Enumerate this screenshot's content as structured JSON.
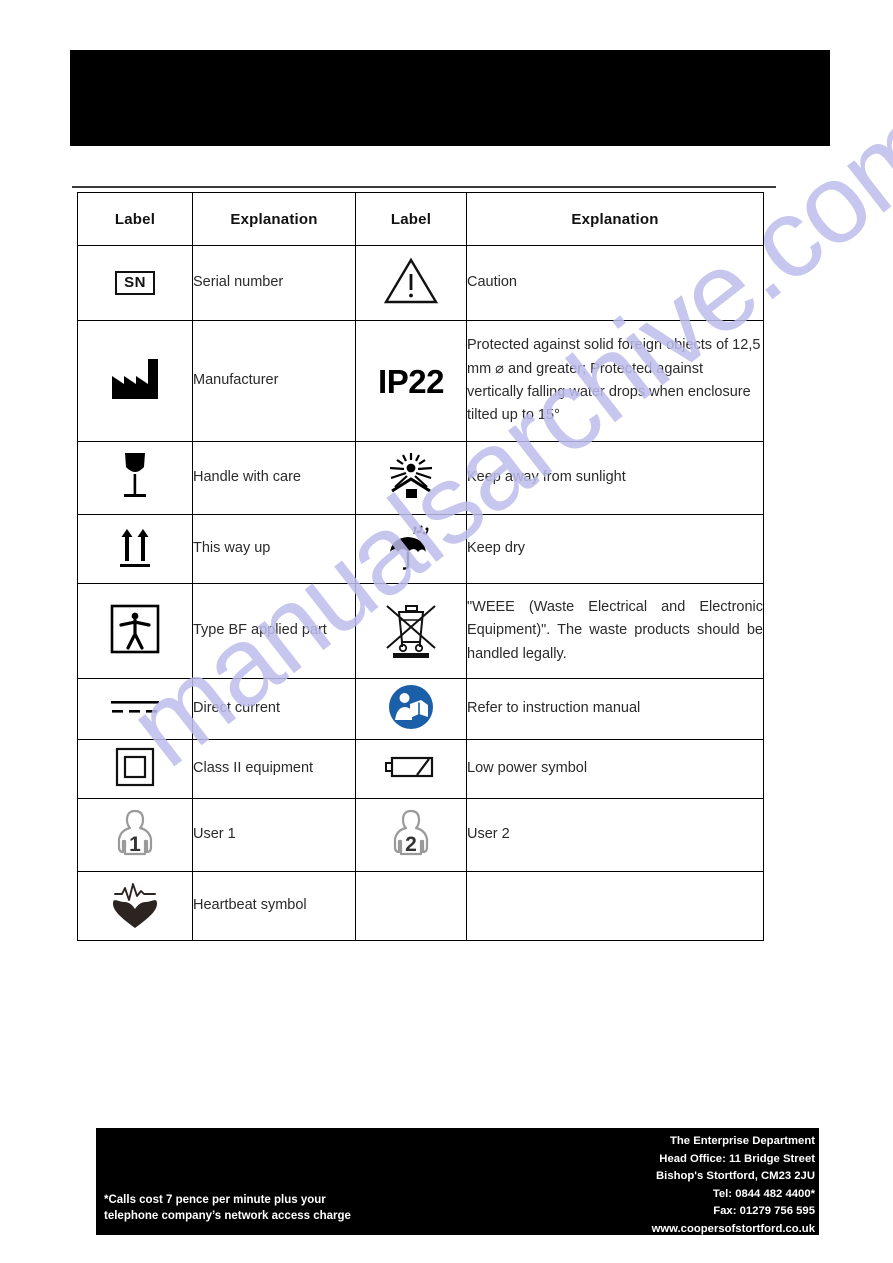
{
  "page": {
    "watermark_text": "manualsarchive.com",
    "watermark_color": "#bdbdec",
    "header_bar_color": "#000000",
    "footer_bar_color": "#000000"
  },
  "table": {
    "headers": [
      "Label",
      "Explanation",
      "Label",
      "Explanation"
    ],
    "rows": [
      {
        "left_icon": "serial-number-icon",
        "left_icon_text": "SN",
        "left_text": "Serial number",
        "right_icon": "caution-triangle-icon",
        "right_icon_text": "",
        "right_text": "Caution"
      },
      {
        "left_icon": "manufacturer-factory-icon",
        "left_icon_text": "",
        "left_text": "Manufacturer",
        "right_icon": "ip-rating-text-icon",
        "right_icon_text": "IP22",
        "right_text": "Protected against solid foreign objects of 12,5 mm ⌀ and greater; Protected against vertically falling water drops when enclosure tilted up to 15°"
      },
      {
        "left_icon": "fragile-glass-icon",
        "left_icon_text": "",
        "left_text": "Handle with care",
        "right_icon": "keep-away-from-sunlight-icon",
        "right_icon_text": "",
        "right_text": "Keep away from sunlight"
      },
      {
        "left_icon": "this-way-up-arrows-icon",
        "left_icon_text": "",
        "left_text": "This way up",
        "right_icon": "keep-dry-umbrella-icon",
        "right_icon_text": "",
        "right_text": "Keep dry"
      },
      {
        "left_icon": "type-bf-applied-part-icon",
        "left_icon_text": "",
        "left_text": "Type BF applied part",
        "right_icon": "weee-crossed-bin-icon",
        "right_icon_text": "",
        "right_text": "\"WEEE (Waste Electrical and Electronic Equipment)\". The waste products should be handled legally."
      },
      {
        "left_icon": "direct-current-icon",
        "left_icon_text": "",
        "left_text": "Direct current",
        "right_icon": "refer-to-instruction-manual-icon",
        "right_icon_text": "",
        "right_text": "Refer to instruction manual"
      },
      {
        "left_icon": "class-ii-equipment-icon",
        "left_icon_text": "",
        "left_text": "Class II equipment",
        "right_icon": "low-battery-icon",
        "right_icon_text": "",
        "right_text": "Low power symbol"
      },
      {
        "left_icon": "user-1-icon",
        "left_icon_text": "1",
        "left_text": "User 1",
        "right_icon": "user-2-icon",
        "right_icon_text": "2",
        "right_text": "User 2"
      },
      {
        "left_icon": "heartbeat-icon",
        "left_icon_text": "",
        "left_text": "Heartbeat symbol",
        "right_icon": "",
        "right_icon_text": "",
        "right_text": ""
      }
    ]
  },
  "footer": {
    "disclaimer_line1": "*Calls cost 7 pence per minute plus your",
    "disclaimer_line2": "telephone company’s  network access charge",
    "company": "The Enterprise Department",
    "head_office": "Head Office:  11 Bridge Street",
    "address": "Bishop's Stortford, CM23 2JU",
    "tel": "Tel: 0844 482 4400*",
    "fax": "Fax: 01279 756 595",
    "website": "www.coopersofstortford.co.uk"
  }
}
